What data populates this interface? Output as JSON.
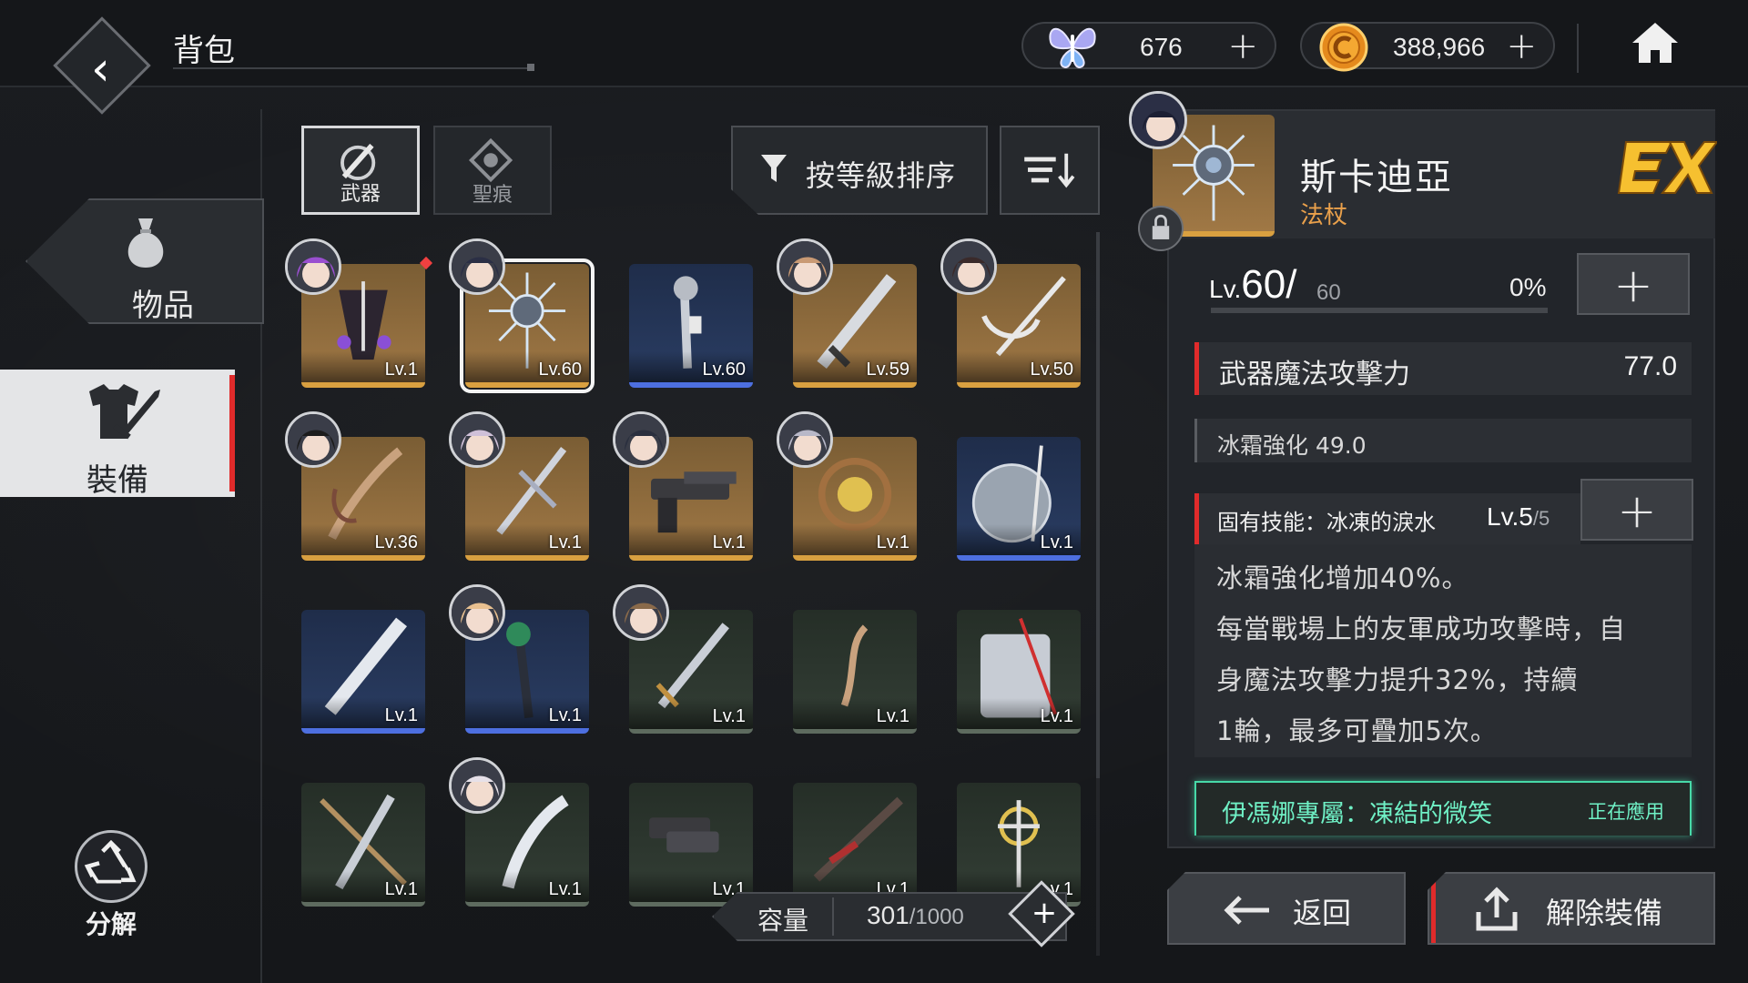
{
  "header": {
    "title": "背包",
    "currency_crystal": "676",
    "currency_gold": "388,966"
  },
  "nav": {
    "items_label": "物品",
    "equipment_label": "裝備",
    "decompose_label": "分解"
  },
  "tabs": {
    "weapon_label": "武器",
    "stigma_label": "聖痕"
  },
  "sort": {
    "label": "按等級排序"
  },
  "grid": {
    "cards": [
      {
        "level": "Lv.1",
        "rarity": "gold",
        "has_avatar": true,
        "red_dot": true
      },
      {
        "level": "Lv.60",
        "rarity": "gold",
        "has_avatar": true,
        "selected": true
      },
      {
        "level": "Lv.60",
        "rarity": "blue",
        "has_avatar": false
      },
      {
        "level": "Lv.59",
        "rarity": "gold",
        "has_avatar": true
      },
      {
        "level": "Lv.50",
        "rarity": "gold",
        "has_avatar": true
      },
      {
        "level": "Lv.36",
        "rarity": "gold",
        "has_avatar": true
      },
      {
        "level": "Lv.1",
        "rarity": "gold",
        "has_avatar": true
      },
      {
        "level": "Lv.1",
        "rarity": "gold",
        "has_avatar": true
      },
      {
        "level": "Lv.1",
        "rarity": "gold",
        "has_avatar": true
      },
      {
        "level": "Lv.1",
        "rarity": "blue",
        "has_avatar": false
      },
      {
        "level": "Lv.1",
        "rarity": "blue",
        "has_avatar": false
      },
      {
        "level": "Lv.1",
        "rarity": "blue",
        "has_avatar": true
      },
      {
        "level": "Lv.1",
        "rarity": "green",
        "has_avatar": true
      },
      {
        "level": "Lv.1",
        "rarity": "green",
        "has_avatar": false
      },
      {
        "level": "Lv.1",
        "rarity": "green",
        "has_avatar": false
      },
      {
        "level": "Lv.1",
        "rarity": "green",
        "has_avatar": false
      },
      {
        "level": "Lv.1",
        "rarity": "green",
        "has_avatar": true
      },
      {
        "level": "Lv.1",
        "rarity": "green",
        "has_avatar": false
      },
      {
        "level": "Lv.1",
        "rarity": "green",
        "has_avatar": false
      },
      {
        "level": "Lv.1",
        "rarity": "green",
        "has_avatar": false
      }
    ]
  },
  "capacity": {
    "label": "容量",
    "current": "301",
    "max": "/1000"
  },
  "detail": {
    "weapon_name": "斯卡迪亞",
    "weapon_type": "法杖",
    "level_prefix": "Lv.",
    "level": "60",
    "level_sep": "/",
    "level_max": "60",
    "exp_percent": "0%",
    "stat_main_name": "武器魔法攻擊力",
    "stat_main_value": "77.0",
    "stat_sub": "冰霜強化 49.0",
    "skill_name": "固有技能：冰凍的淚水",
    "skill_level": "Lv.5",
    "skill_level_max": "/5",
    "skill_desc": [
      "冰霜強化增加40%。",
      "每當戰場上的友軍成功攻擊時，自",
      "身魔法攻擊力提升32%，持續",
      "1輪，最多可疊加5次。"
    ],
    "exclusive_name": "伊馮娜專屬：凍結的微笑",
    "exclusive_status": "正在應用"
  },
  "buttons": {
    "back_label": "返回",
    "unequip_label": "解除裝備"
  },
  "colors": {
    "accent_red": "#e02b2b",
    "gold_rarity": "#d9a040",
    "blue_rarity": "#4d6fe0",
    "exclusive_green": "#6ff0c5",
    "weapon_type_orange": "#e9a04b"
  }
}
